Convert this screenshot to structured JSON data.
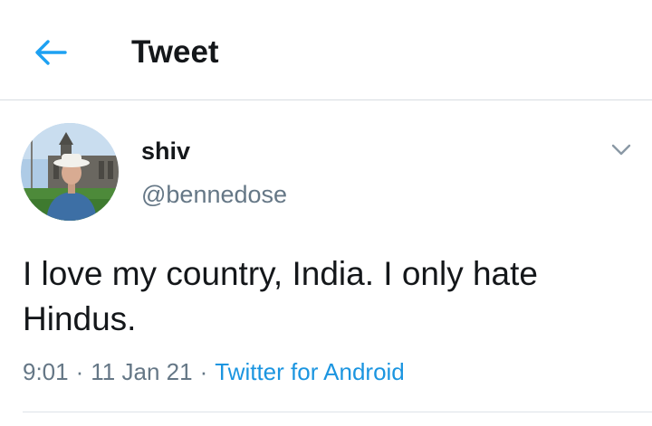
{
  "header": {
    "title": "Tweet",
    "back_icon": "arrow-left-icon",
    "accent_color": "#1da1f2"
  },
  "tweet": {
    "author": {
      "display_name": "shiv",
      "handle": "@bennedose",
      "avatar": "profile-photo"
    },
    "text": "I love my country, India. I only hate Hindus.",
    "time": "9:01",
    "date": "11 Jan 21",
    "separator": "·",
    "source": "Twitter for Android",
    "source_color": "#1b95e0",
    "menu_icon": "chevron-down-icon"
  }
}
